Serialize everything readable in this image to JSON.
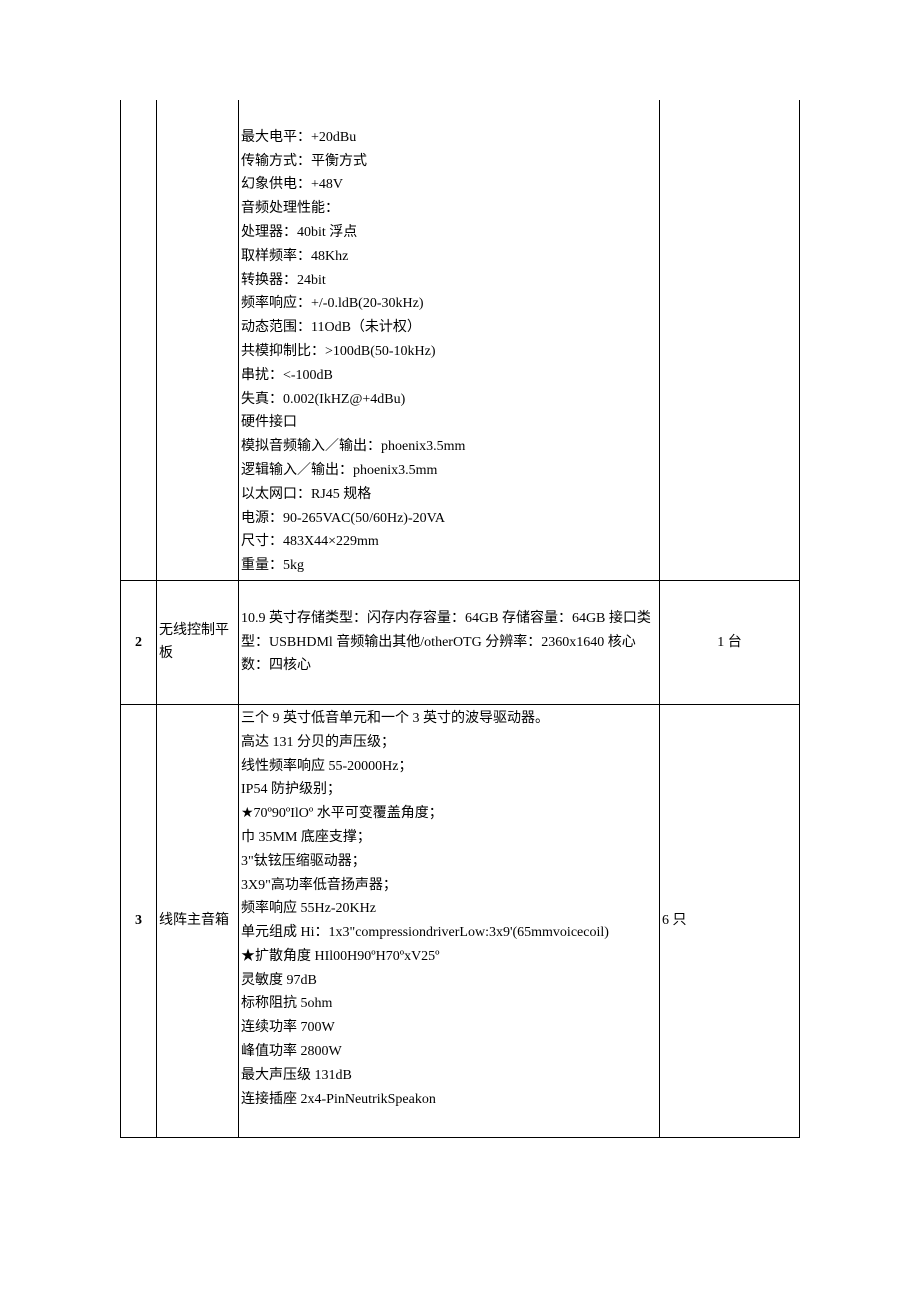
{
  "rows": [
    {
      "num": "",
      "name": "",
      "qty": "",
      "spec_lines": [
        "",
        "最大电平：+20dBu",
        "传输方式：平衡方式",
        "幻象供电：+48V",
        "音频处理性能：",
        "处理器：40bit 浮点",
        "取样频率：48Khz",
        "转换器：24bit",
        "频率响应：+/-0.ldB(20-30kHz)",
        "动态范围：11OdB（未计权）",
        "共模抑制比：>100dB(50-10kHz)",
        "串扰：<-100dB",
        "失真：0.002(IkHZ@+4dBu)",
        "硬件接口",
        "模拟音频输入／输出：phoenix3.5mm",
        "逻辑输入／输出：phoenix3.5mm",
        "以太网口：RJ45 规格",
        "电源：90-265VAC(50/60Hz)-20VA",
        "尺寸：483X44×229mm",
        "重量：5kg"
      ]
    },
    {
      "num": "2",
      "name": "无线控制平板",
      "qty": "1 台",
      "spec_lines": [
        "",
        "10.9 英寸存储类型：闪存内存容量：64GB 存储容量：64GB 接口类型：USBHDMl 音频输出其他/otherOTG 分辨率：2360x1640 核心数：四核心",
        ""
      ]
    },
    {
      "num": "3",
      "name": "线阵主音箱",
      "qty": "6 只",
      "spec_lines": [
        "三个 9 英寸低音单元和一个 3 英寸的波导驱动器。",
        "高达 131 分贝的声压级；",
        "线性频率响应 55-20000Hz；",
        "IP54 防护级别；",
        "★70º90ºIlOº 水平可变覆盖角度；",
        "巾 35MM 底座支撑；",
        "3\"钛铉压缩驱动器；",
        "3X9\"高功率低音扬声器；",
        "频率响应 55Hz-20KHz",
        "单元组成 Hi：1x3\"compressiondriverLow:3x9'(65mmvoicecoil)",
        "★扩散角度 HIl00H90ºH70ºxV25º",
        "灵敏度 97dB",
        "标称阻抗 5ohm",
        "连续功率 700W",
        "峰值功率 2800W",
        "最大声压级 131dB",
        "连接插座 2x4-PinNeutrikSpeakon",
        ""
      ]
    }
  ]
}
